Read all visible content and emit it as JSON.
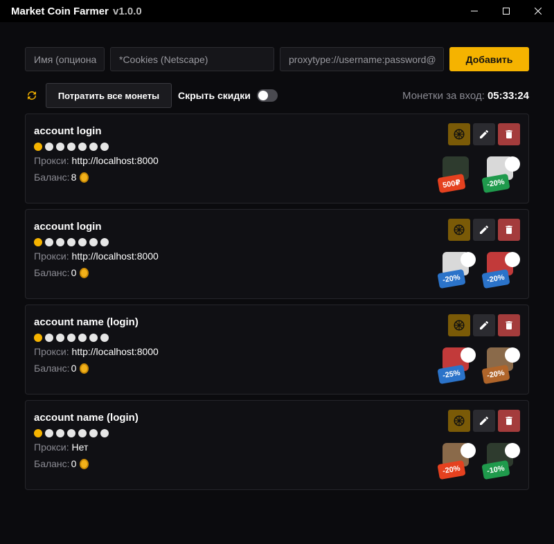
{
  "app": {
    "title": "Market Coin Farmer",
    "version": "v1.0.0"
  },
  "inputs": {
    "name_placeholder": "Имя (опциона",
    "cookies_placeholder": "*Cookies (Netscape)",
    "proxy_placeholder": "proxytype://username:password@",
    "add_label": "Добавить"
  },
  "toolbar": {
    "refresh_icon": "refresh-icon",
    "spend_label": "Потратить все монеты",
    "hide_discounts_label": "Скрыть скидки",
    "hide_discounts_on": false,
    "coins_label": "Монетки за вход:",
    "coins_timer": "05:33:24"
  },
  "labels": {
    "proxy": "Прокси:",
    "balance": "Баланс:"
  },
  "colors": {
    "accent": "#f5b300",
    "delete": "#a43c3c",
    "wheel": "#7a5a07"
  },
  "accounts": [
    {
      "name": "account login",
      "proxy": "http://localhost:8000",
      "balance": "8",
      "streak_filled": 1,
      "streak_total": 7,
      "rewards": [
        {
          "tag": "500₽",
          "color": "red"
        },
        {
          "tag": "-20%",
          "color": "green"
        }
      ]
    },
    {
      "name": "account login",
      "proxy": "http://localhost:8000",
      "balance": "0",
      "streak_filled": 1,
      "streak_total": 7,
      "rewards": [
        {
          "tag": "-20%",
          "color": "blue"
        },
        {
          "tag": "-20%",
          "color": "blue"
        }
      ]
    },
    {
      "name": "account name (login)",
      "proxy": "http://localhost:8000",
      "balance": "0",
      "streak_filled": 1,
      "streak_total": 7,
      "rewards": [
        {
          "tag": "-25%",
          "color": "blue"
        },
        {
          "tag": "-20%",
          "color": "brown"
        }
      ]
    },
    {
      "name": "account name (login)",
      "proxy": "Нет",
      "balance": "0",
      "streak_filled": 1,
      "streak_total": 7,
      "rewards": [
        {
          "tag": "-20%",
          "color": "red"
        },
        {
          "tag": "-10%",
          "color": "green"
        }
      ]
    }
  ]
}
